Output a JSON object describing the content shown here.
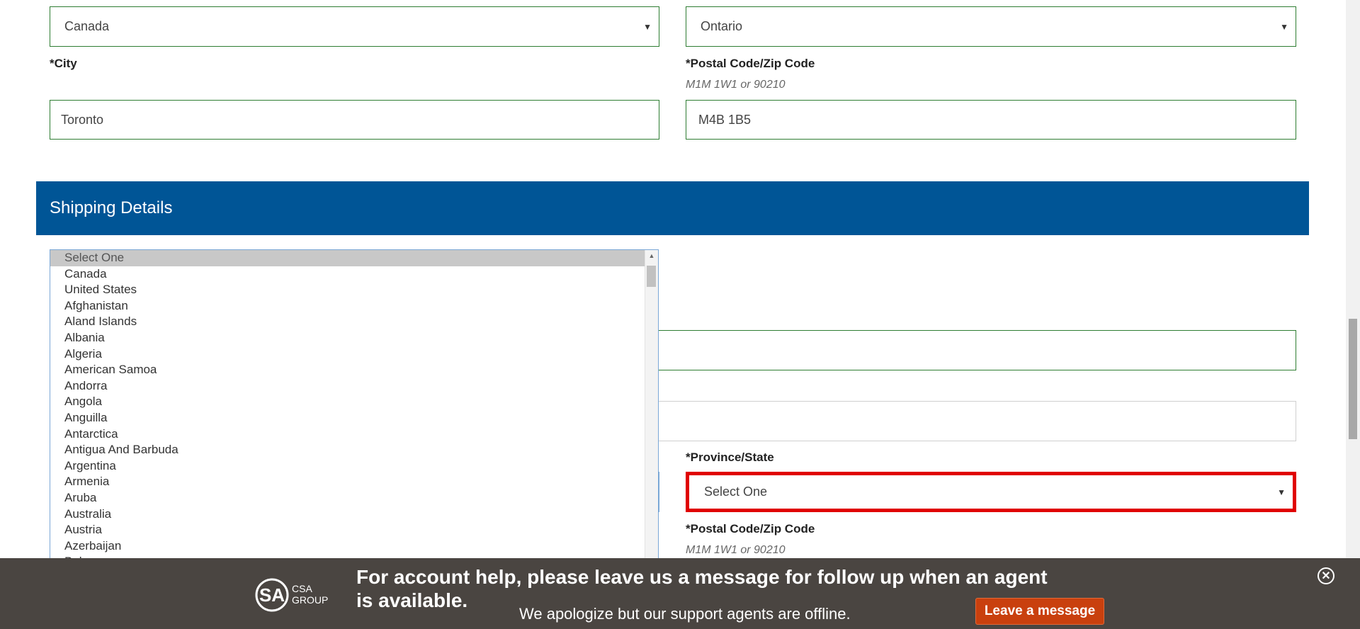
{
  "billing": {
    "country": "Canada",
    "province": "Ontario",
    "city_label": "City",
    "city_value": "Toronto",
    "postal_label": "Postal Code/Zip Code",
    "postal_hint": "M1M 1W1 or 90210",
    "postal_value": "M4B 1B5"
  },
  "shipping": {
    "section_title": "Shipping Details",
    "province_label": "Province/State",
    "province_value": "Select One",
    "postal_label": "Postal Code/Zip Code",
    "postal_hint": "M1M 1W1 or 90210",
    "country_options": [
      "Select One",
      "Canada",
      "United States",
      "Afghanistan",
      "Aland Islands",
      "Albania",
      "Algeria",
      "American Samoa",
      "Andorra",
      "Angola",
      "Anguilla",
      "Antarctica",
      "Antigua And Barbuda",
      "Argentina",
      "Armenia",
      "Aruba",
      "Australia",
      "Austria",
      "Azerbaijan",
      "Bahamas"
    ],
    "selected_option": "Select One"
  },
  "chat": {
    "title": "For account help, please leave us a message for follow up when an agent is available.",
    "subtitle": "We apologize but our support agents are offline.",
    "button_label": "Leave a message",
    "logo_text_top": "CSA",
    "logo_text_bottom": "GROUP"
  },
  "colors": {
    "section_bar": "#005596",
    "field_border": "#2e7d32",
    "error_border": "#e00000",
    "chat_background": "#4a4541",
    "chat_button": "#c9400e"
  }
}
